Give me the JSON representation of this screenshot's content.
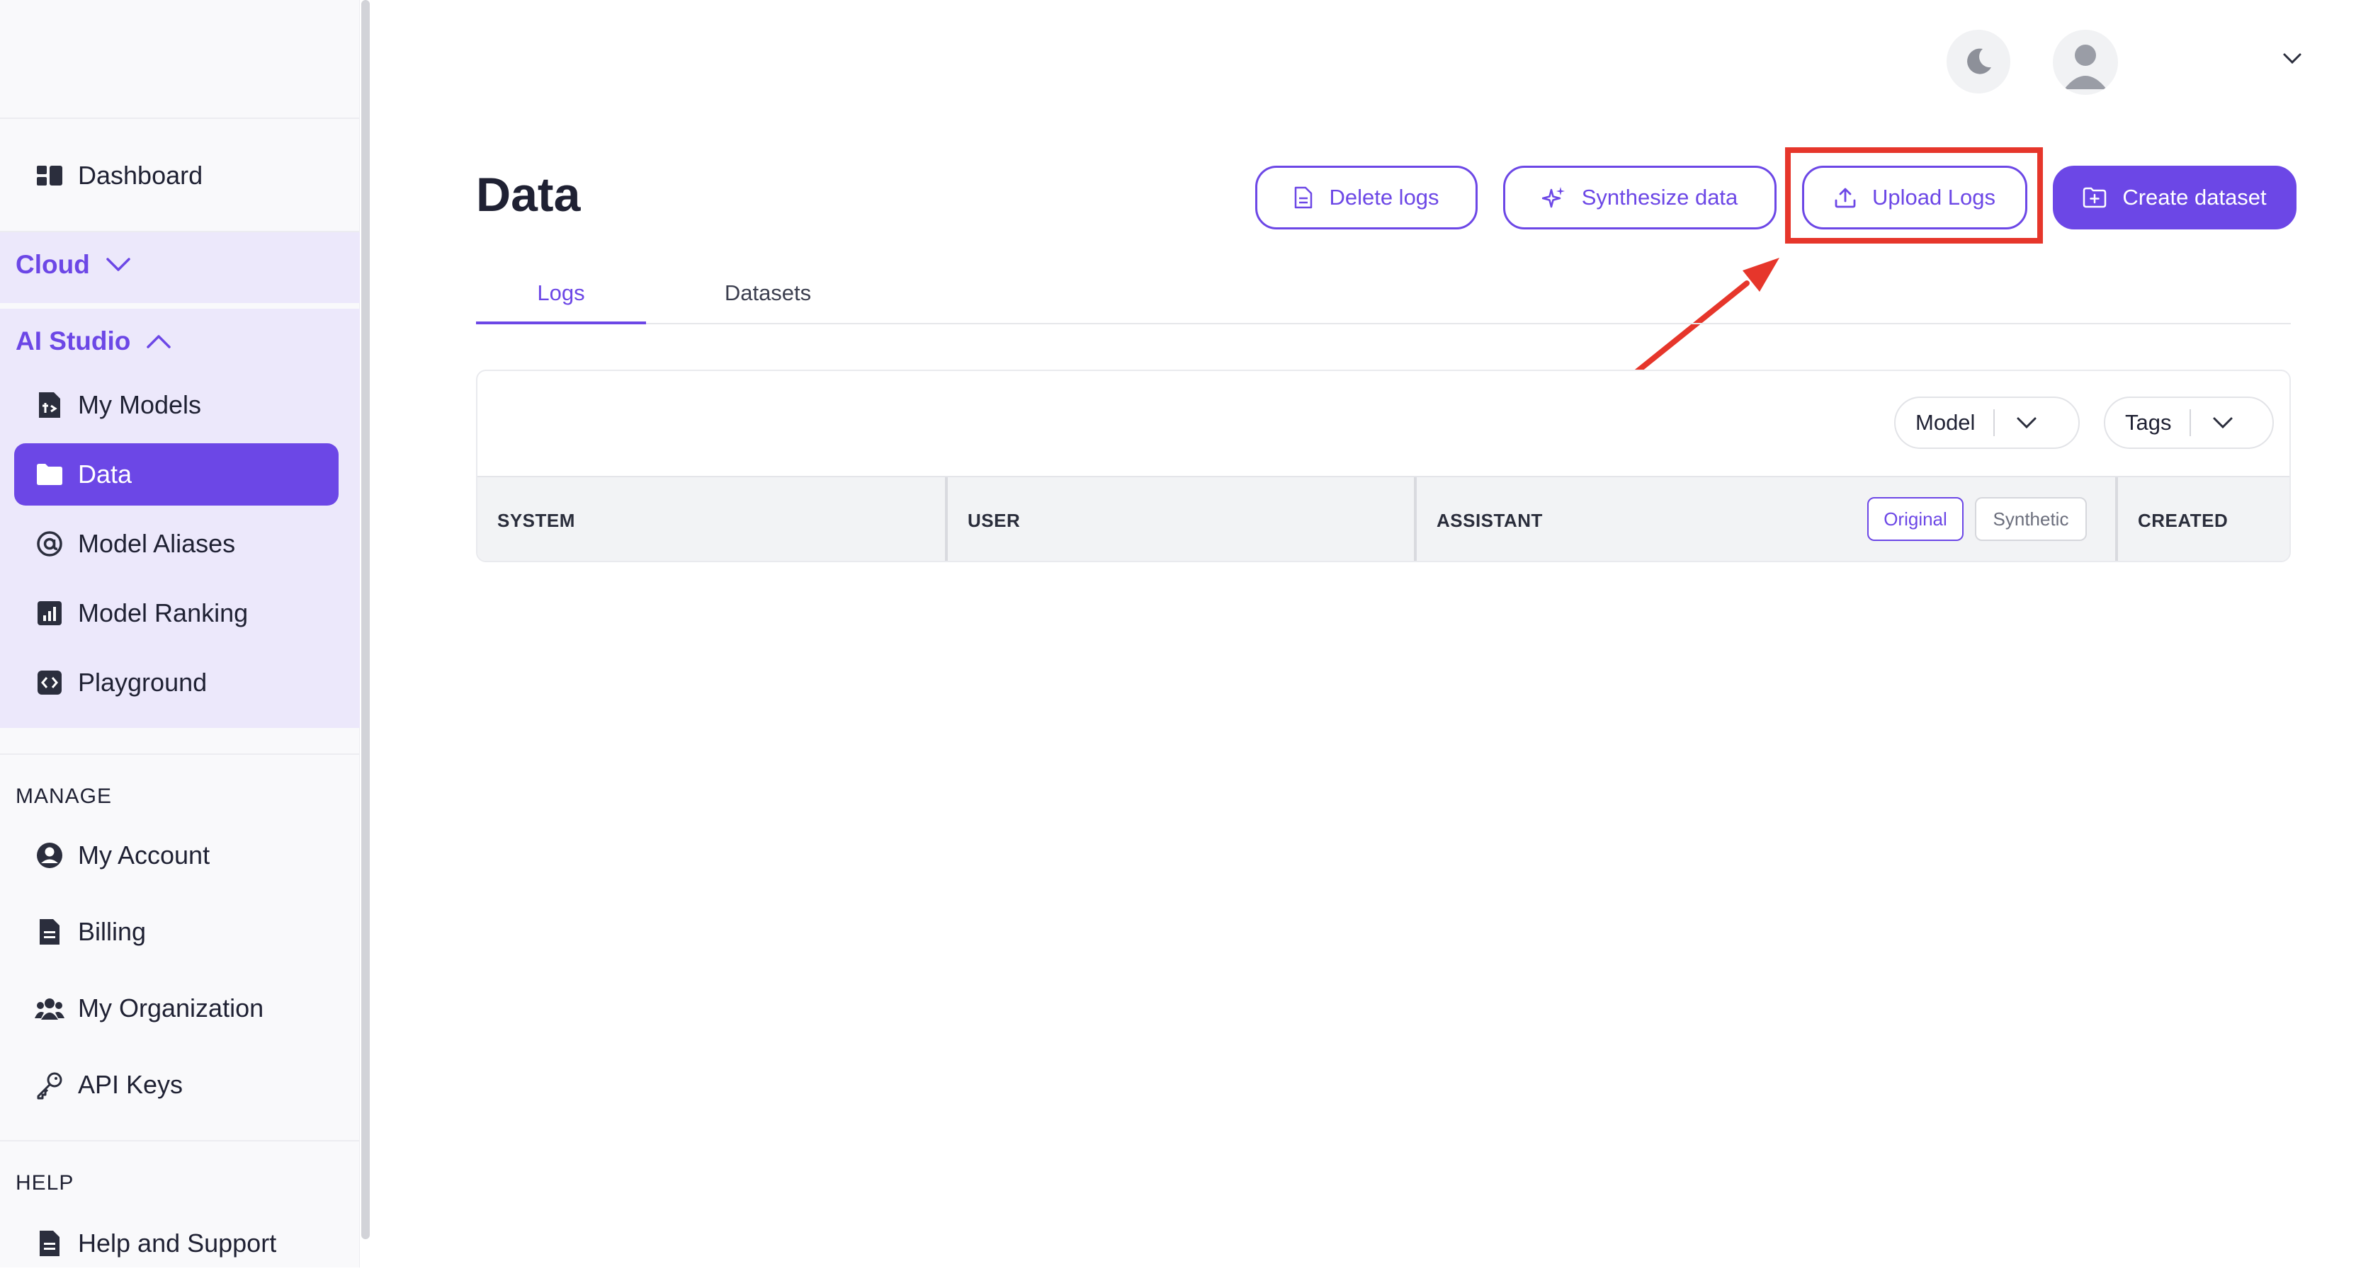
{
  "sidebar": {
    "dashboard": "Dashboard",
    "cloud_group": "Cloud",
    "studio_group": "AI Studio",
    "studio_items": [
      "My Models",
      "Data",
      "Model Aliases",
      "Model Ranking",
      "Playground"
    ],
    "manage_section": "MANAGE",
    "manage_items": [
      "My Account",
      "Billing",
      "My Organization",
      "API Keys"
    ],
    "help_section": "HELP",
    "help_items": [
      "Help and Support"
    ]
  },
  "header": {
    "title": "Data",
    "delete_logs": "Delete logs",
    "synthesize_data": "Synthesize data",
    "upload_logs": "Upload Logs",
    "create_dataset": "Create dataset"
  },
  "tabs": [
    "Logs",
    "Datasets"
  ],
  "filters": {
    "model": "Model",
    "tags": "Tags"
  },
  "table": {
    "columns": [
      "SYSTEM",
      "USER",
      "ASSISTANT",
      "CREATED"
    ],
    "assistant_toggle": [
      "Original",
      "Synthetic"
    ]
  },
  "colors": {
    "accent": "#6c47e6",
    "annotation": "#e6362b"
  }
}
